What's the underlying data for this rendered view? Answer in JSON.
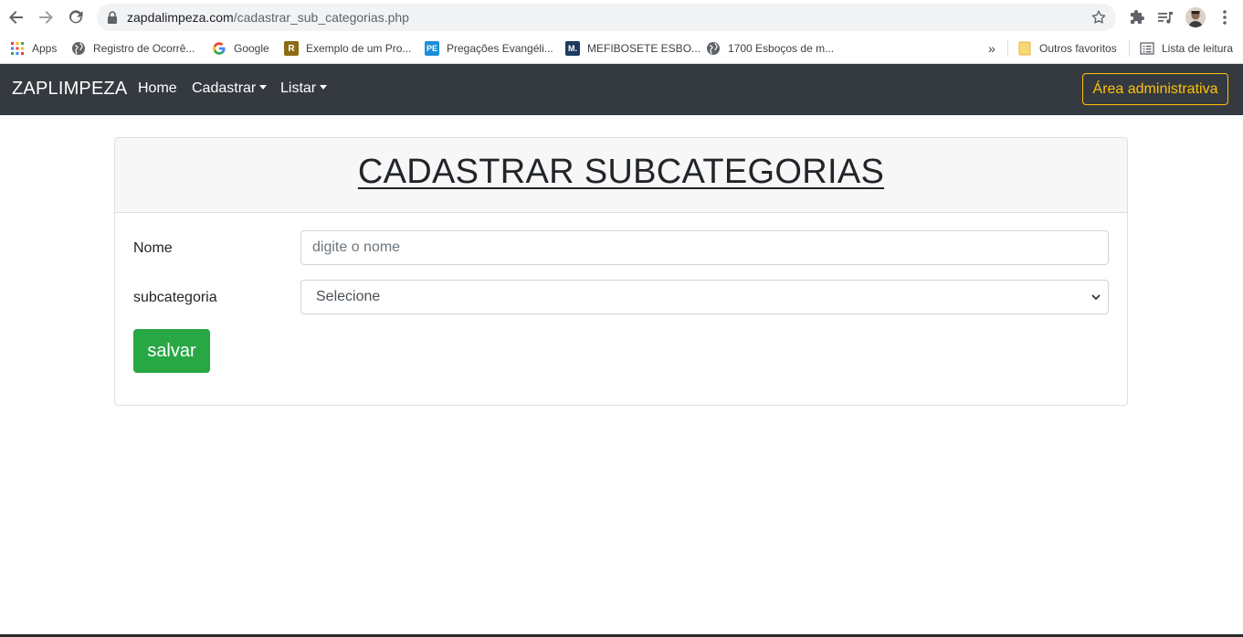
{
  "browser": {
    "url_host": "zapdalimpeza.com",
    "url_path": "/cadastrar_sub_categorias.php"
  },
  "bookmarks": {
    "apps": "Apps",
    "items": [
      "Registro de Ocorrê...",
      "Google",
      "Exemplo de um Pro...",
      "Pregações Evangéli...",
      "MEFIBOSETE ESBO...",
      "1700 Esboços de m..."
    ],
    "more": "»",
    "other_favorites": "Outros favoritos",
    "reading_list": "Lista de leitura"
  },
  "navbar": {
    "brand": "ZAPLIMPEZA",
    "links": [
      "Home",
      "Cadastrar",
      "Listar"
    ],
    "admin_button": "Área administrativa"
  },
  "form": {
    "title": "CADASTRAR SUBCATEGORIAS",
    "name_label": "Nome",
    "name_placeholder": "digite o nome",
    "sub_label": "subcategoria",
    "sub_selected": "Selecione",
    "save_button": "salvar"
  },
  "colors": {
    "navbar_bg": "#343a40",
    "admin_outline": "#ffc107",
    "save_green": "#28a745"
  }
}
